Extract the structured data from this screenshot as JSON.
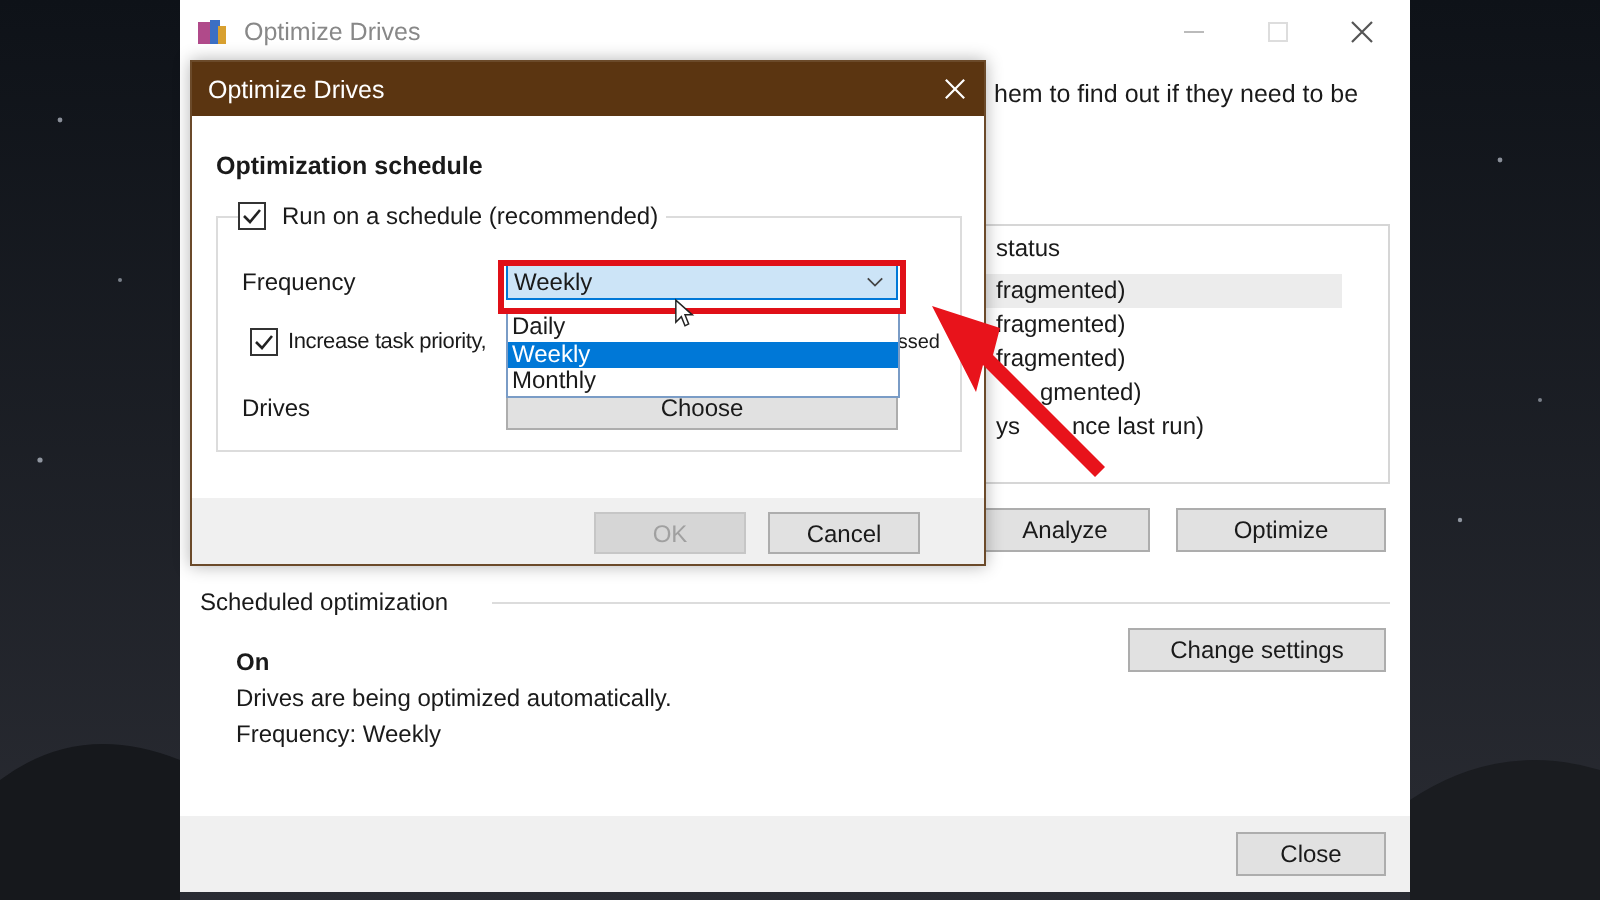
{
  "main_window": {
    "title": "Optimize Drives",
    "intro_text": "hem to find out if they need to be",
    "table": {
      "columns": [
        "status"
      ],
      "rows": [
        {
          "status": "fragmented)",
          "selected": true
        },
        {
          "status": "fragmented)",
          "selected": false
        },
        {
          "status": "fragmented)",
          "selected": false
        },
        {
          "status": "gmented)",
          "selected": false
        },
        {
          "status": "ys",
          "status_end": "nce last run)",
          "selected": false
        }
      ]
    },
    "buttons": [
      "Analyze",
      "Optimize"
    ],
    "scheduled": {
      "heading": "Scheduled optimization",
      "state": "On",
      "description": "Drives are being optimized automatically.",
      "frequency": "Frequency: Weekly",
      "button": "Change settings"
    },
    "footer_button": "Close"
  },
  "dialog": {
    "title": "Optimize Drives",
    "heading": "Optimization schedule",
    "run_on_schedule": {
      "label": "Run on a schedule (recommended)",
      "checked": true
    },
    "frequency": {
      "label": "Frequency",
      "value": "Weekly",
      "expanded": true,
      "options": [
        {
          "label": "Daily",
          "selected": false
        },
        {
          "label": "Weekly",
          "selected": true
        },
        {
          "label": "Monthly",
          "selected": false
        }
      ]
    },
    "priority": {
      "label_start": "Increase task priority,",
      "label_end": "ssed",
      "checked": true
    },
    "drives": {
      "label": "Drives",
      "button": "Choose"
    },
    "buttons": [
      {
        "label": "OK",
        "disabled": true
      },
      {
        "label": "Cancel",
        "disabled": false
      }
    ]
  }
}
